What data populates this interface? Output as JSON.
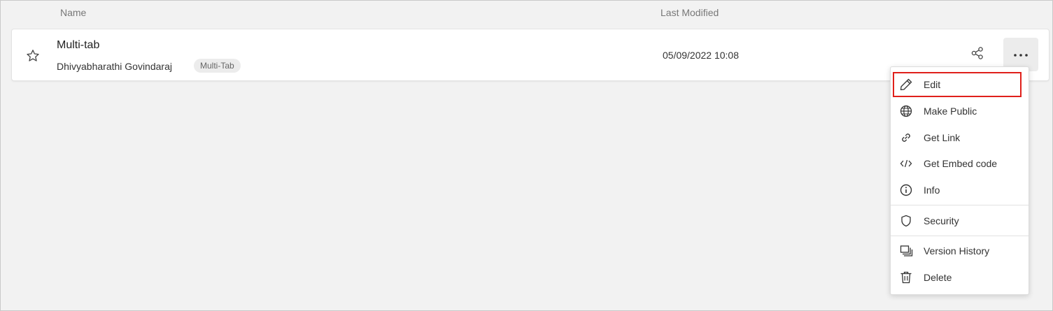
{
  "columns": {
    "name": "Name",
    "last_modified": "Last Modified"
  },
  "item": {
    "title": "Multi-tab",
    "owner": "Dhivyabharathi Govindaraj",
    "tag": "Multi-Tab",
    "modified": "05/09/2022 10:08"
  },
  "menu": {
    "items": [
      {
        "label": "Edit",
        "icon": "pencil-icon"
      },
      {
        "label": "Make Public",
        "icon": "globe-icon"
      },
      {
        "label": "Get Link",
        "icon": "link-icon"
      },
      {
        "label": "Get Embed code",
        "icon": "code-icon"
      },
      {
        "label": "Info",
        "icon": "info-icon"
      },
      {
        "label": "Security",
        "icon": "shield-icon"
      },
      {
        "label": "Version History",
        "icon": "versions-icon"
      },
      {
        "label": "Delete",
        "icon": "trash-icon"
      }
    ]
  },
  "colors": {
    "highlight": "#e0201b",
    "background": "#f2f2f2",
    "card": "#ffffff"
  }
}
